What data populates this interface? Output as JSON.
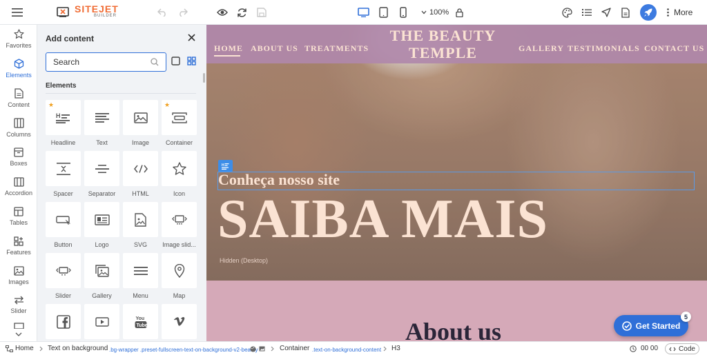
{
  "app": {
    "logo_text": "SITEJET",
    "logo_sub": "BUILDER",
    "zoom": "100%",
    "more_label": "More",
    "accent": "#2f6fd8",
    "brand_color": "#f06c34"
  },
  "rail": {
    "items": [
      {
        "label": "Favorites",
        "icon": "star-icon"
      },
      {
        "label": "Elements",
        "icon": "cube-icon"
      },
      {
        "label": "Content",
        "icon": "document-icon"
      },
      {
        "label": "Columns",
        "icon": "columns-icon"
      },
      {
        "label": "Boxes",
        "icon": "box-icon"
      },
      {
        "label": "Accordion",
        "icon": "accordion-icon"
      },
      {
        "label": "Tables",
        "icon": "table-icon"
      },
      {
        "label": "Features",
        "icon": "features-icon"
      },
      {
        "label": "Images",
        "icon": "image-icon"
      },
      {
        "label": "Slider",
        "icon": "slider-icon"
      }
    ],
    "active": "Elements"
  },
  "panel": {
    "title": "Add content",
    "search_placeholder": "Search",
    "section": "Elements",
    "tiles": [
      {
        "label": "Headline",
        "icon": "headline-icon",
        "starred": true
      },
      {
        "label": "Text",
        "icon": "text-icon",
        "starred": false
      },
      {
        "label": "Image",
        "icon": "image-icon",
        "starred": false
      },
      {
        "label": "Container",
        "icon": "container-icon",
        "starred": true
      },
      {
        "label": "Spacer",
        "icon": "spacer-icon",
        "starred": false
      },
      {
        "label": "Separator",
        "icon": "separator-icon",
        "starred": false
      },
      {
        "label": "HTML",
        "icon": "html-icon",
        "starred": false
      },
      {
        "label": "Icon",
        "icon": "star-outline-icon",
        "starred": false
      },
      {
        "label": "Button",
        "icon": "button-icon",
        "starred": false
      },
      {
        "label": "Logo",
        "icon": "logo-icon",
        "starred": false
      },
      {
        "label": "SVG",
        "icon": "svg-icon",
        "starred": false
      },
      {
        "label": "Image slid...",
        "icon": "image-slider-icon",
        "starred": false
      },
      {
        "label": "Slider",
        "icon": "slider-icon",
        "starred": false
      },
      {
        "label": "Gallery",
        "icon": "gallery-icon",
        "starred": false
      },
      {
        "label": "Menu",
        "icon": "menu-icon",
        "starred": false
      },
      {
        "label": "Map",
        "icon": "map-pin-icon",
        "starred": false
      },
      {
        "label": "",
        "icon": "facebook-icon",
        "starred": false
      },
      {
        "label": "",
        "icon": "video-icon",
        "starred": false
      },
      {
        "label": "",
        "icon": "youtube-icon",
        "starred": false
      },
      {
        "label": "",
        "icon": "vimeo-icon",
        "starred": false
      }
    ]
  },
  "site": {
    "brand_line1": "THE BEAUTY",
    "brand_line2": "TEMPLE",
    "nav_left": [
      "HOME",
      "ABOUT US",
      "TREATMENTS"
    ],
    "nav_right": [
      "GALLERY",
      "TESTIMONIALS",
      "CONTACT US"
    ],
    "subheading": "Conheça nosso site",
    "heading": "SAIBA MAIS",
    "hidden_note": "Hidden (Desktop)",
    "about_heading": "About us",
    "cta_label": "Get Started",
    "cta_count": "5"
  },
  "breadcrumb": {
    "home": "Home",
    "section": "Text on background",
    "section_classes": ".bg-wrapper .preset-fullscreen-text-on-background-v2-beauty",
    "container": "Container",
    "container_classes": ".text-on-background-content",
    "element": "H3",
    "time": "00 00",
    "code_label": "Code"
  }
}
